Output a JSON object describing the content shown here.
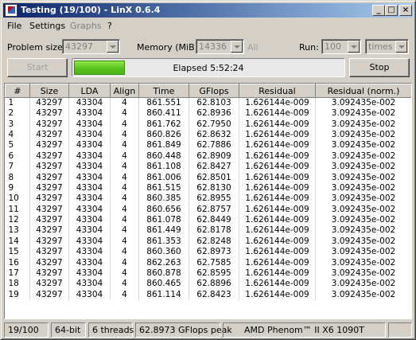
{
  "window": {
    "title": "Testing (19/100) - LinX 0.6.4",
    "min_glyph": "_",
    "max_glyph": "□",
    "close_glyph": "×"
  },
  "menu": [
    "File",
    "Settings",
    "Graphs",
    "?"
  ],
  "controls": {
    "problem_size_label": "Problem size:",
    "problem_size_value": "43297",
    "memory_label": "Memory (MiB):",
    "memory_value": "14336",
    "all_label": "All",
    "run_label": "Run:",
    "run_value": "100",
    "run_unit": "times"
  },
  "actions": {
    "start_label": "Start",
    "stop_label": "Stop",
    "elapsed_text": "Elapsed 5:52:24",
    "progress_fraction": 0.19
  },
  "table": {
    "columns": [
      "#",
      "Size",
      "LDA",
      "Align",
      "Time",
      "GFlops",
      "Residual",
      "Residual (norm.)"
    ],
    "rows": [
      [
        "1",
        "43297",
        "43304",
        "4",
        "861.551",
        "62.8103",
        "1.626144e-009",
        "3.092435e-002"
      ],
      [
        "2",
        "43297",
        "43304",
        "4",
        "860.411",
        "62.8936",
        "1.626144e-009",
        "3.092435e-002"
      ],
      [
        "3",
        "43297",
        "43304",
        "4",
        "861.762",
        "62.7950",
        "1.626144e-009",
        "3.092435e-002"
      ],
      [
        "4",
        "43297",
        "43304",
        "4",
        "860.826",
        "62.8632",
        "1.626144e-009",
        "3.092435e-002"
      ],
      [
        "5",
        "43297",
        "43304",
        "4",
        "861.849",
        "62.7886",
        "1.626144e-009",
        "3.092435e-002"
      ],
      [
        "6",
        "43297",
        "43304",
        "4",
        "860.448",
        "62.8909",
        "1.626144e-009",
        "3.092435e-002"
      ],
      [
        "7",
        "43297",
        "43304",
        "4",
        "861.108",
        "62.8427",
        "1.626144e-009",
        "3.092435e-002"
      ],
      [
        "8",
        "43297",
        "43304",
        "4",
        "861.006",
        "62.8501",
        "1.626144e-009",
        "3.092435e-002"
      ],
      [
        "9",
        "43297",
        "43304",
        "4",
        "861.515",
        "62.8130",
        "1.626144e-009",
        "3.092435e-002"
      ],
      [
        "10",
        "43297",
        "43304",
        "4",
        "860.385",
        "62.8955",
        "1.626144e-009",
        "3.092435e-002"
      ],
      [
        "11",
        "43297",
        "43304",
        "4",
        "860.656",
        "62.8757",
        "1.626144e-009",
        "3.092435e-002"
      ],
      [
        "12",
        "43297",
        "43304",
        "4",
        "861.078",
        "62.8449",
        "1.626144e-009",
        "3.092435e-002"
      ],
      [
        "13",
        "43297",
        "43304",
        "4",
        "861.449",
        "62.8178",
        "1.626144e-009",
        "3.092435e-002"
      ],
      [
        "14",
        "43297",
        "43304",
        "4",
        "861.353",
        "62.8248",
        "1.626144e-009",
        "3.092435e-002"
      ],
      [
        "15",
        "43297",
        "43304",
        "4",
        "860.360",
        "62.8973",
        "1.626144e-009",
        "3.092435e-002"
      ],
      [
        "16",
        "43297",
        "43304",
        "4",
        "862.263",
        "62.7585",
        "1.626144e-009",
        "3.092435e-002"
      ],
      [
        "17",
        "43297",
        "43304",
        "4",
        "860.878",
        "62.8595",
        "1.626144e-009",
        "3.092435e-002"
      ],
      [
        "18",
        "43297",
        "43304",
        "4",
        "860.465",
        "62.8896",
        "1.626144e-009",
        "3.092435e-002"
      ],
      [
        "19",
        "43297",
        "43304",
        "4",
        "861.114",
        "62.8423",
        "1.626144e-009",
        "3.092435e-002"
      ]
    ]
  },
  "status": {
    "progress": "19/100",
    "arch": "64-bit",
    "threads": "6 threads",
    "peak": "62.8973 GFlops peak",
    "cpu": "AMD Phenom™ II X6 1090T"
  },
  "colors": {
    "title_bar_start": "#0a246a",
    "title_bar_end": "#a6caf0",
    "progress_fill": "#58c21c",
    "window_face": "#d4d0c8"
  }
}
